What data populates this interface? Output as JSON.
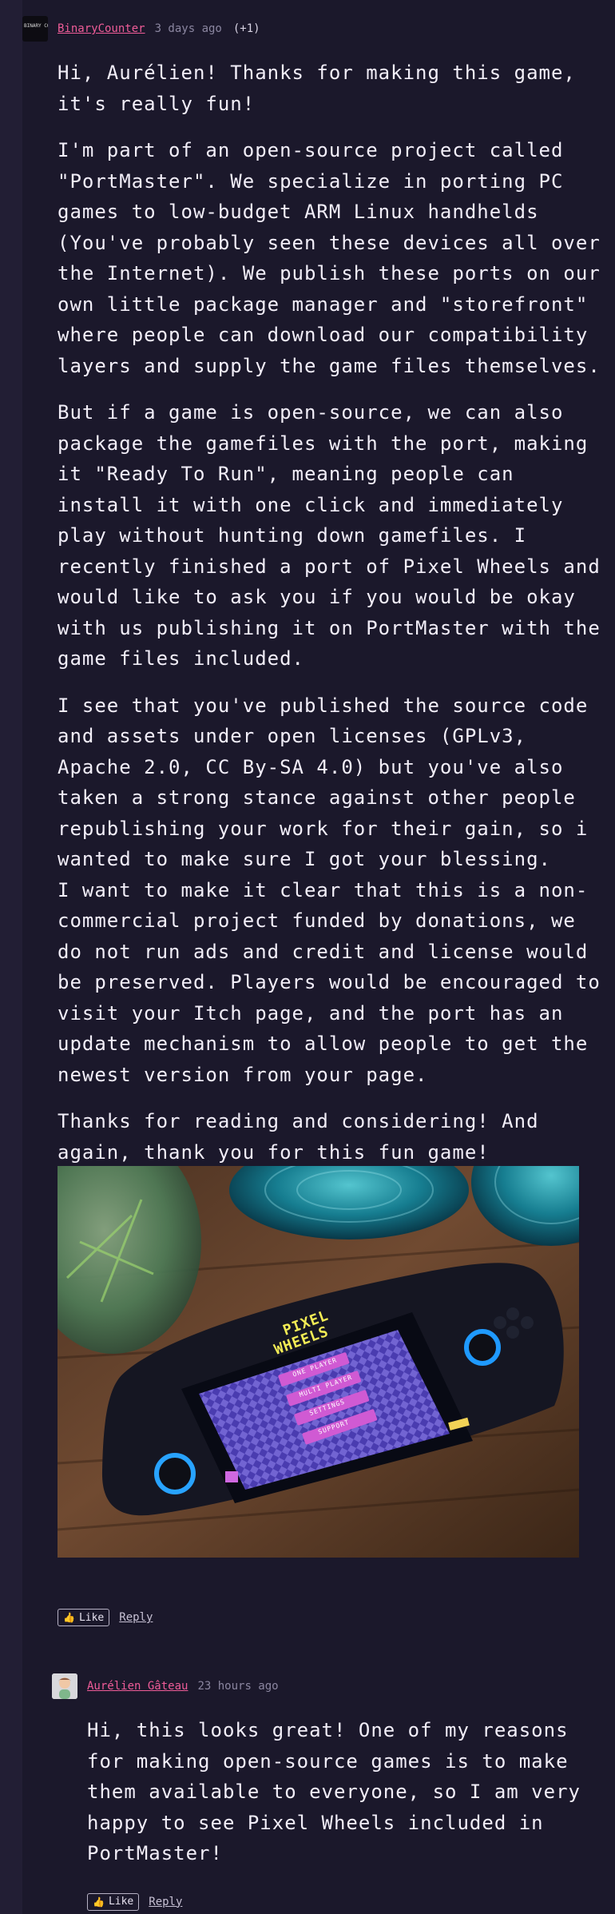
{
  "comment": {
    "author": "BinaryCounter",
    "avatar_text": "BINARY COUNTER",
    "time": "3 days ago",
    "score": "(+1)",
    "paragraphs": [
      "Hi, Aurélien! Thanks for making this game, it's really fun!",
      "I'm part of an open-source project called \"PortMaster\". We specialize in porting PC games to low-budget ARM Linux handhelds (You've probably seen these devices all over the Internet). We publish these ports on our own little package manager and \"storefront\" where people can download our compatibility layers and supply the game files themselves.",
      "But if a game is open-source, we can also package the gamefiles with the port, making it \"Ready To Run\", meaning people can install it with one click and immediately play without hunting down gamefiles. I recently finished a port of Pixel Wheels and would like to ask you if you would be okay with us publishing it on PortMaster with the game files included.",
      "I see that you've published the source code and assets under open licenses (GPLv3, Apache 2.0, CC By-SA 4.0) but you've also taken a strong stance against other people republishing your work for their gain, so i wanted to make sure I got your blessing.",
      "I want to make it clear that this is a non-commercial project funded by donations, we do not run ads and credit and license would be preserved. Players would be encouraged to visit your Itch page, and the port has an update mechanism to allow people to get the newest version from your page.",
      "Thanks for reading and considering! And again, thank you for this fun game!"
    ],
    "photo": {
      "game_title_line1": "PIXEL",
      "game_title_line2": "WHEELS",
      "menu_items": [
        "ONE PLAYER",
        "MULTI PLAYER",
        "SETTINGS",
        "SUPPORT"
      ]
    },
    "like_label": "Like",
    "reply_label": "Reply"
  },
  "reply": {
    "author": "Aurélien Gâteau",
    "time": "23 hours ago",
    "text": "Hi, this looks great! One of my reasons for making open-source games is to make them available to everyone, so I am very happy to see Pixel Wheels included in PortMaster!",
    "like_label": "Like",
    "reply_label": "Reply"
  },
  "colors": {
    "background": "#1b182b",
    "author_link": "#ef5c98",
    "meta": "#8b86a0",
    "body_text": "#f2eef8"
  },
  "icons": {
    "like": "thumbs-up-icon"
  }
}
